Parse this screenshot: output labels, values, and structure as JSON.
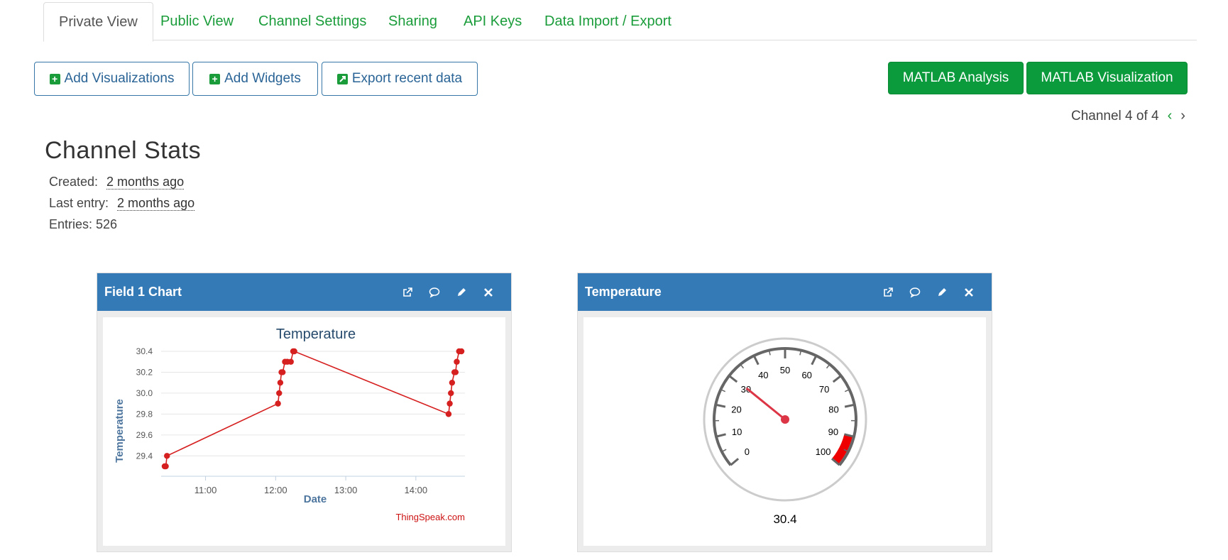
{
  "tabs": [
    {
      "label": "Private View",
      "active": true
    },
    {
      "label": "Public View"
    },
    {
      "label": "Channel Settings"
    },
    {
      "label": "Sharing"
    },
    {
      "label": "API Keys"
    },
    {
      "label": "Data Import / Export"
    }
  ],
  "toolbar": {
    "add_visualizations": "Add Visualizations",
    "add_widgets": "Add Widgets",
    "export_recent": "Export recent data",
    "matlab_analysis": "MATLAB Analysis",
    "matlab_visualization": "MATLAB Visualization"
  },
  "pager": {
    "text": "Channel 4 of 4"
  },
  "stats": {
    "title": "Channel Stats",
    "created_label": "Created:",
    "created_value": "2 months ago",
    "last_entry_label": "Last entry:",
    "last_entry_value": "2 months ago",
    "entries": "Entries: 526"
  },
  "colors": {
    "green": "#0b9a3c",
    "blue": "#337ab7",
    "series": "#d62020"
  },
  "field_chart": {
    "panel_title": "Field 1 Chart",
    "watermark": "ThingSpeak.com"
  },
  "gauge": {
    "panel_title": "Temperature",
    "value": 30.4,
    "value_label": "30.4",
    "min": 0,
    "max": 100,
    "ticks": [
      "0",
      "10",
      "20",
      "30",
      "40",
      "50",
      "60",
      "70",
      "80",
      "90",
      "100"
    ],
    "red_band": [
      90,
      100
    ]
  },
  "chart_data": {
    "type": "line",
    "title": "Temperature",
    "xlabel": "Date",
    "ylabel": "Temperature",
    "x_ticks": [
      "11:00",
      "12:00",
      "13:00",
      "14:00"
    ],
    "y_ticks": [
      "29.4",
      "29.6",
      "29.8",
      "30.0",
      "30.2",
      "30.4"
    ],
    "ylim": [
      29.3,
      30.4
    ],
    "xlim": [
      "10:22",
      "14:42"
    ],
    "grid": true,
    "series": [
      {
        "color": "#d62020",
        "points": [
          [
            "10:25",
            29.3
          ],
          [
            "10:26",
            29.3
          ],
          [
            "10:27",
            29.4
          ],
          [
            "12:02",
            29.9
          ],
          [
            "12:03",
            30.0
          ],
          [
            "12:04",
            30.1
          ],
          [
            "12:05",
            30.2
          ],
          [
            "12:06",
            30.2
          ],
          [
            "12:08",
            30.3
          ],
          [
            "12:10",
            30.3
          ],
          [
            "12:13",
            30.3
          ],
          [
            "12:15",
            30.4
          ],
          [
            "12:16",
            30.4
          ],
          [
            "14:28",
            29.8
          ],
          [
            "14:29",
            29.9
          ],
          [
            "14:30",
            30.0
          ],
          [
            "14:31",
            30.1
          ],
          [
            "14:33",
            30.2
          ],
          [
            "14:34",
            30.2
          ],
          [
            "14:35",
            30.3
          ],
          [
            "14:37",
            30.4
          ],
          [
            "14:39",
            30.4
          ]
        ]
      }
    ]
  }
}
